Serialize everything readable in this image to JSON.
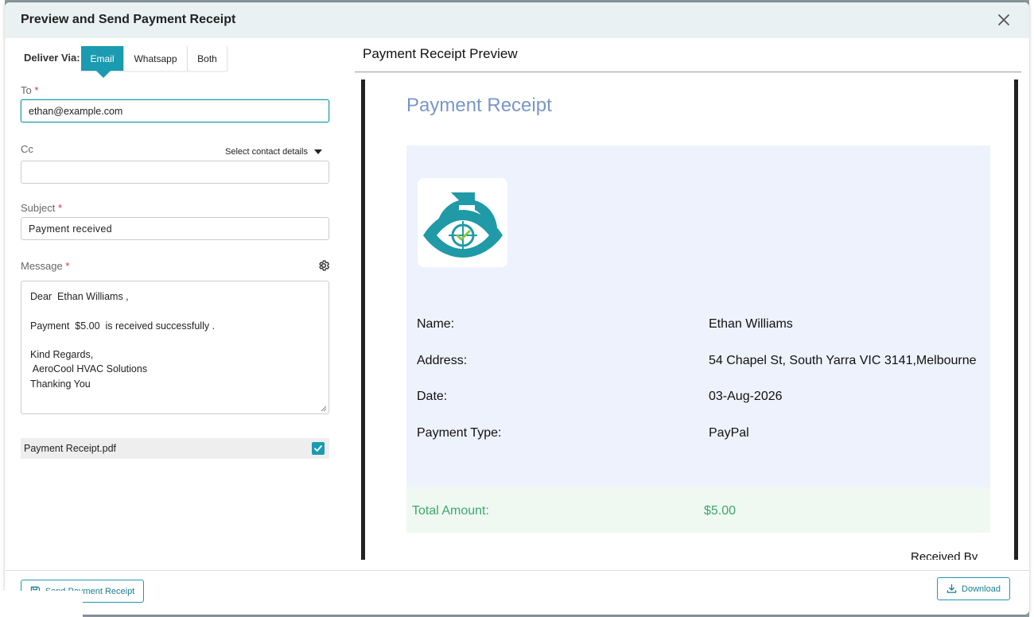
{
  "modal": {
    "title": "Preview and Send Payment Receipt"
  },
  "deliver": {
    "label": "Deliver Via:",
    "options": [
      "Email",
      "Whatsapp",
      "Both"
    ],
    "selected": "Email"
  },
  "form": {
    "to_label": "To",
    "to_value": "ethan@example.com",
    "cc_label": "Cc",
    "cc_value": "",
    "contact_select_label": "Select contact details",
    "subject_label": "Subject",
    "subject_value": "Payment received",
    "message_label": "Message",
    "message_lines": [
      "Dear  Ethan Williams ,",
      "",
      "Payment  $5.00  is received successfully .",
      "",
      "Kind Regards,",
      " AeroCool HVAC Solutions",
      "Thanking You"
    ],
    "attachment_name": "Payment Receipt.pdf",
    "attachment_checked": true,
    "required_marker": "*"
  },
  "preview": {
    "title": "Payment Receipt Preview",
    "heading": "Payment Receipt",
    "rows": [
      {
        "label": "Name:",
        "value": "Ethan Williams"
      },
      {
        "label": "Address:",
        "value": "54 Chapel St, South Yarra VIC 3141,Melbourne"
      },
      {
        "label": "Date:",
        "value": "03-Aug-2026"
      },
      {
        "label": "Payment Type:",
        "value": "PayPal"
      }
    ],
    "total_label": "Total Amount:",
    "total_value": "$5.00",
    "received_by": "Received By"
  },
  "footer": {
    "send_label": "Send Payment Receipt",
    "download_label": "Download"
  },
  "colors": {
    "accent": "#1a9bb1",
    "header_bg": "#e9f1f3",
    "receipt_heading": "#7896c8",
    "total_green": "#3aa96a"
  },
  "icons": [
    "close-icon",
    "caret-down-icon",
    "gear-icon",
    "checkbox-check-icon",
    "save-icon",
    "download-icon",
    "company-logo"
  ]
}
